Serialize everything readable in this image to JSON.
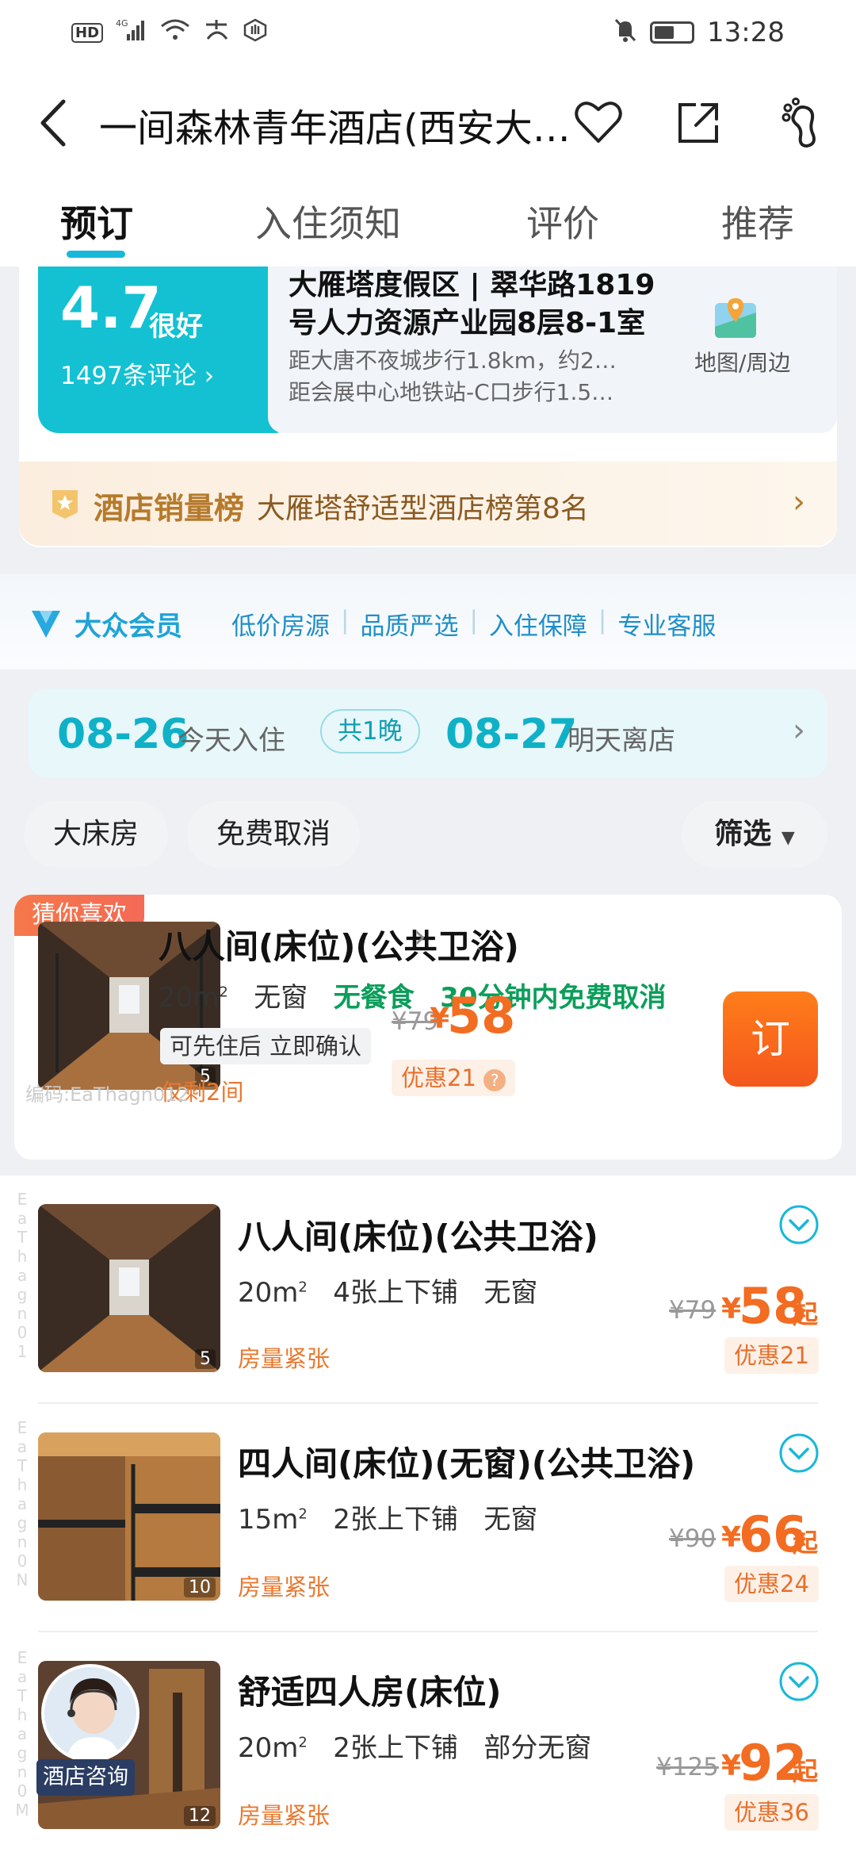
{
  "status_bar": {
    "time": "13:28",
    "network": "4G",
    "hd": "HD"
  },
  "header": {
    "title": "一间森林青年酒店(西安大…"
  },
  "tabs": [
    "预订",
    "入住须知",
    "评价",
    "推荐"
  ],
  "rating": {
    "score": "4.7",
    "label": "很好",
    "reviews": "1497条评论 ›"
  },
  "address": {
    "line": "大雁塔度假区 | 翠华路1819号人力资源产业园8层8-1室",
    "dist1": "距大唐不夜城步行1.8km，约2…",
    "dist2": "距会展中心地铁站-C口步行1.5…",
    "map_label": "地图/周边"
  },
  "ranking": {
    "title": "酒店销量榜",
    "text": "大雁塔舒适型酒店榜第8名"
  },
  "member": {
    "title": "大众会员",
    "items": [
      "低价房源",
      "品质严选",
      "入住保障",
      "专业客服"
    ]
  },
  "dates": {
    "checkin": "08-26",
    "checkin_sub": "今天入住",
    "nights": "共1晚",
    "checkout": "08-27",
    "checkout_sub": "明天离店"
  },
  "filters": [
    "大床房",
    "免费取消",
    "筛选"
  ],
  "featured_room": {
    "tag": "猜你喜欢",
    "name": "八人间(床位)(公共卫浴)",
    "area": "20m",
    "window": "无窗",
    "meal": "无餐食",
    "cancel": "30分钟内免费取消",
    "pills": [
      "可先住后付",
      "立即确认"
    ],
    "remaining": "仅剩2间",
    "code": "编码:EaThagn012",
    "orig_price": "¥79",
    "yen": "¥",
    "price": "58",
    "discount": "优惠21",
    "book": "订",
    "photo_count": "5"
  },
  "rooms": [
    {
      "name": "八人间(床位)(公共卫浴)",
      "area": "20m",
      "beds": "4张上下铺",
      "window": "无窗",
      "status": "房量紧张",
      "orig_price": "¥79",
      "yen": "¥",
      "price": "58",
      "suffix": "起",
      "discount": "优惠21",
      "photo_count": "5",
      "watermark": "EaThagn01"
    },
    {
      "name": "四人间(床位)(无窗)(公共卫浴)",
      "area": "15m",
      "beds": "2张上下铺",
      "window": "无窗",
      "status": "房量紧张",
      "orig_price": "¥90",
      "yen": "¥",
      "price": "66",
      "suffix": "起",
      "discount": "优惠24",
      "photo_count": "10",
      "watermark": "EaThagn0N"
    },
    {
      "name": "舒适四人房(床位)",
      "area": "20m",
      "beds": "2张上下铺",
      "window": "部分无窗",
      "status": "房量紧张",
      "orig_price": "¥125",
      "yen": "¥",
      "price": "92",
      "suffix": "起",
      "discount": "优惠36",
      "photo_count": "12",
      "watermark": "EaThagn0M"
    }
  ],
  "consult": {
    "label": "酒店咨询"
  },
  "colors": {
    "accent": "#19b8d8",
    "price": "#f26c21",
    "green": "#0b9e5a"
  }
}
